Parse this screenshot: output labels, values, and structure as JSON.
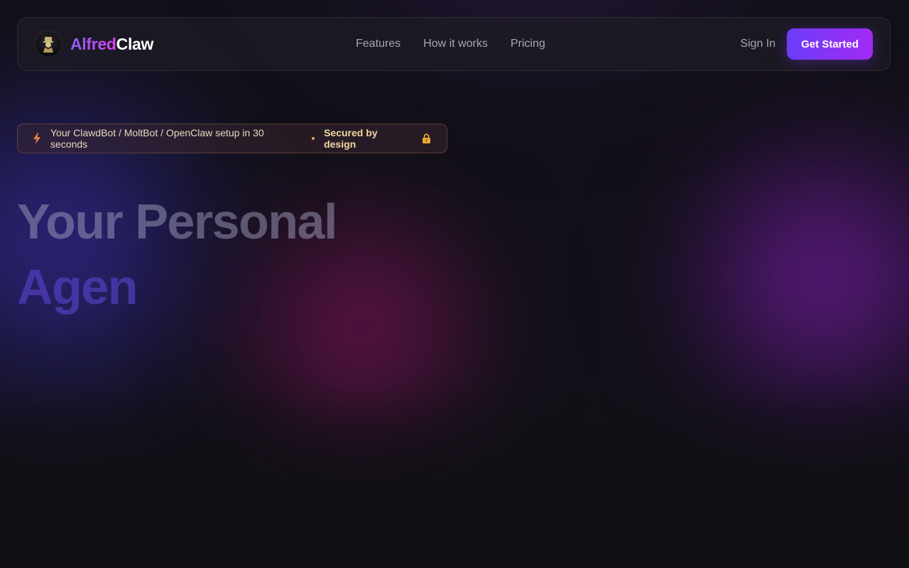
{
  "brand": {
    "name_part1": "Alfred",
    "name_part2": "Claw",
    "logo_icon": "butler-logo-icon"
  },
  "nav": {
    "links": [
      "Features",
      "How it works",
      "Pricing"
    ],
    "sign_in": "Sign In",
    "get_started": "Get Started"
  },
  "badge": {
    "text": "Your ClawdBot / MoltBot / OpenClaw setup in 30 seconds",
    "highlight": "Secured by design",
    "leading_icon": "lightning-icon",
    "trailing_icon": "lock-icon"
  },
  "hero": {
    "line1": "Your Personal",
    "line2": "Agen"
  },
  "colors": {
    "accent_start": "#6d3cf7",
    "accent_end": "#a12bf4",
    "badge_text": "#e9d7c0",
    "background": "#121018"
  }
}
